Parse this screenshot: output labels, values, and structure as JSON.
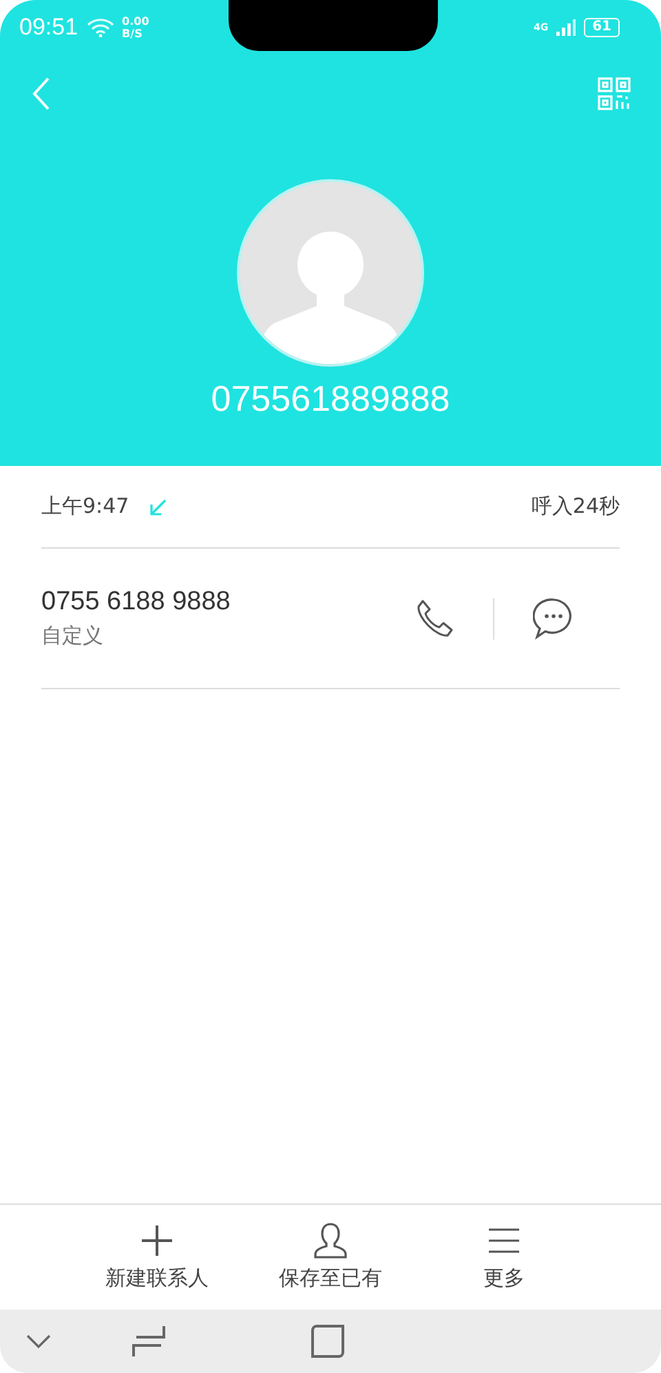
{
  "status_bar": {
    "time": "09:51",
    "speed_value": "0.00",
    "speed_unit": "B/S",
    "network": "4G",
    "battery": "61"
  },
  "contact": {
    "number": "075561889888"
  },
  "call": {
    "time": "上午9:47",
    "incoming": true,
    "duration": "呼入24秒"
  },
  "phone": {
    "number": "0755 6188 9888",
    "label": "自定义"
  },
  "actions": [
    {
      "kind": "add",
      "label": "新建联系人"
    },
    {
      "kind": "person",
      "label": "保存至已有"
    },
    {
      "kind": "menu",
      "label": "更多"
    }
  ]
}
